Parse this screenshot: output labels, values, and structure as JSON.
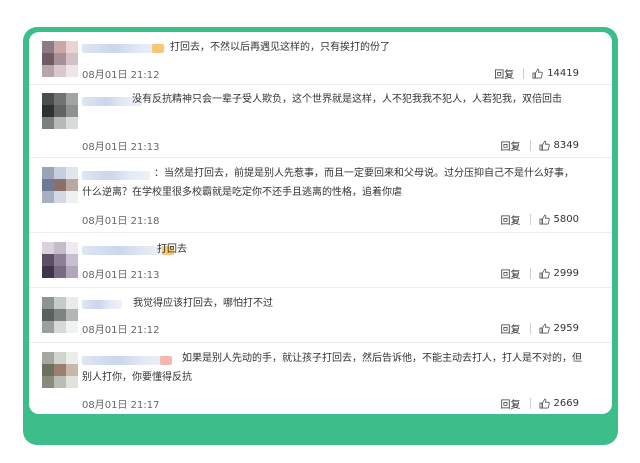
{
  "comments": [
    {
      "text": "打回去，不然以后再遇见这样的，只有挨打的份了",
      "date": "08月01日 21:12",
      "reply_label": "回复",
      "likes": "14419"
    },
    {
      "text": "没有反抗精神只会一辈子受人欺负，这个世界就是这样，人不犯我我不犯人，人若犯我，双倍回击",
      "date": "08月01日 21:13",
      "reply_label": "回复",
      "likes": "8349"
    },
    {
      "text": "：当然是打回去，前提是别人先惹事，而且一定要回来和父母说。过分压抑自己不是什么好事，什么逆离？在学校里很多校霸就是吃定你不还手且逃离的性格，追着你虐",
      "date": "08月01日 21:18",
      "reply_label": "回复",
      "likes": "5800"
    },
    {
      "text": "打回去",
      "date": "08月01日 21:13",
      "reply_label": "回复",
      "likes": "2999"
    },
    {
      "text": "我觉得应该打回去，哪怕打不过",
      "date": "08月01日 21:12",
      "reply_label": "回复",
      "likes": "2959"
    },
    {
      "text": "如果是别人先动的手，就让孩子打回去，然后告诉他，不能主动去打人，打人是不对的，但别人打你，你要懂得反抗",
      "date": "08月01日 21:17",
      "reply_label": "回复",
      "likes": "2669"
    }
  ],
  "colors": {
    "frame": "#3dbd8a",
    "card": "#ffffff",
    "text": "#333333",
    "date": "#666666"
  },
  "icons": {
    "like": "thumbs-up-icon"
  }
}
